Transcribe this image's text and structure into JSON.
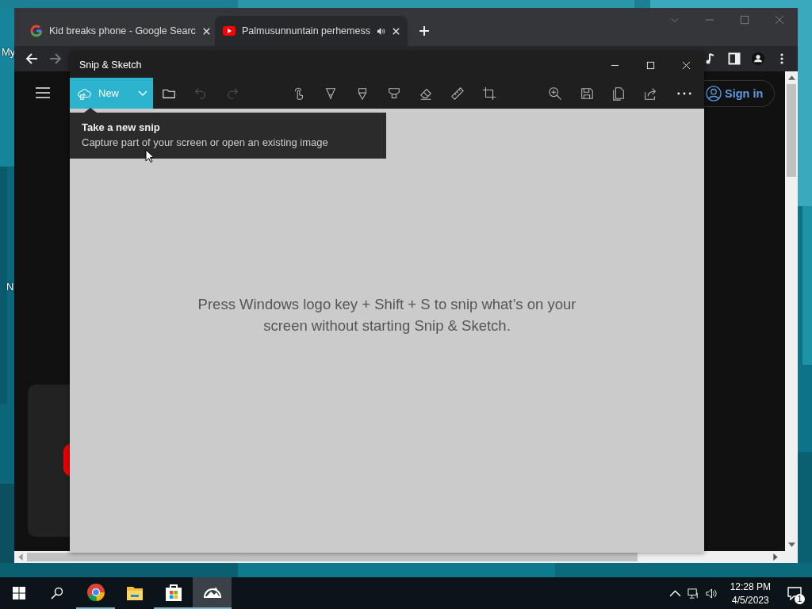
{
  "desktop": {
    "wallpaper": {
      "kind": "picture"
    },
    "icon_labels": [
      "My",
      "N"
    ]
  },
  "browser": {
    "tabs": [
      {
        "title": "Kid breaks phone - Google Searc",
        "kind": "google",
        "audio": false,
        "selected": false
      },
      {
        "title": "Palmusunnuntain perhemess",
        "kind": "youtube",
        "audio": true,
        "selected": true
      }
    ],
    "sign_in": "Sign in"
  },
  "snip_window": {
    "title": "Snip & Sketch",
    "new_button": "New",
    "tool_groups": [
      [
        {
          "kind": "folder",
          "disabled": false
        },
        {
          "kind": "undo",
          "disabled": true
        },
        {
          "kind": "redo",
          "disabled": true
        }
      ],
      [
        {
          "kind": "touch",
          "disabled": false
        },
        {
          "kind": "pen",
          "disabled": false
        },
        {
          "kind": "pencil",
          "disabled": false
        },
        {
          "kind": "highlighter",
          "disabled": false
        },
        {
          "kind": "eraser",
          "disabled": false
        },
        {
          "kind": "ruler",
          "disabled": false
        },
        {
          "kind": "crop",
          "disabled": false
        }
      ],
      [
        {
          "kind": "zoom",
          "disabled": false
        },
        {
          "kind": "save",
          "disabled": false
        },
        {
          "kind": "copy",
          "disabled": false
        },
        {
          "kind": "share",
          "disabled": false
        }
      ]
    ],
    "tooltip": {
      "title": "Take a new snip",
      "text": "Capture part of your screen or open an existing image"
    },
    "message": "Press Windows logo key + Shift + S to snip what’s on your screen without starting Snip & Sketch."
  },
  "taskbar": {
    "apps": [
      {
        "kind": "chrome",
        "running": true,
        "selected": false
      },
      {
        "kind": "explorer",
        "running": false,
        "selected": false
      },
      {
        "kind": "store",
        "running": true,
        "selected": false
      },
      {
        "kind": "snip",
        "running": true,
        "selected": true
      }
    ],
    "time": "12:28 PM",
    "date": "4/5/2023",
    "notification_count": "1"
  }
}
